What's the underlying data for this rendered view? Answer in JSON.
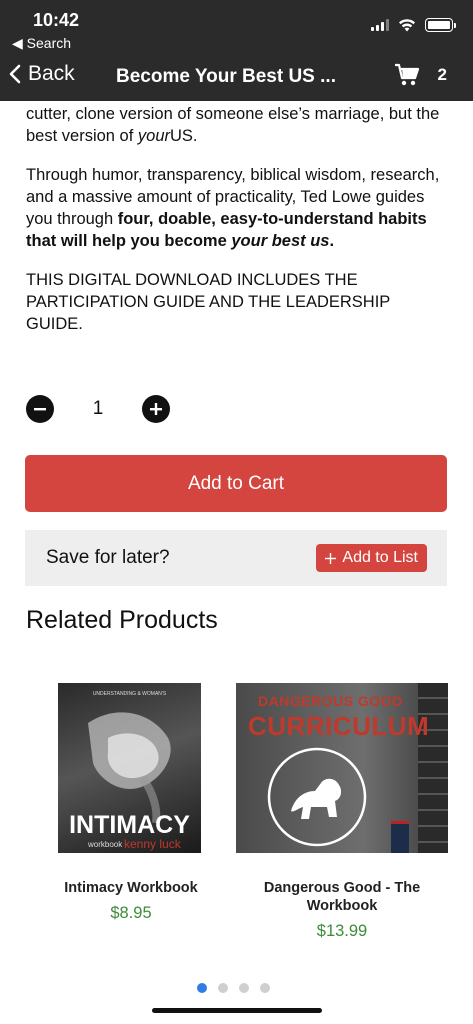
{
  "status": {
    "time": "10:42",
    "back_app": "◀ Search"
  },
  "nav": {
    "back_label": "Back",
    "title": "Become Your Best US ...",
    "cart_count": "2"
  },
  "description": {
    "p1_text": "cutter, clone version of someone else’s marriage, but the best version of ",
    "p1_italic": "your",
    "p1_tail": "US.",
    "p2_text": "Through humor, transparency, biblical wisdom, research, and a massive amount of practicality, Ted Lowe guides you through ",
    "p2_bold": "four, doable, easy-to-understand habits that will help you become ",
    "p2_bold_italic": "your best us",
    "p2_bold_end": ".",
    "p3_text": "THIS DIGITAL DOWNLOAD INCLUDES THE PARTICIPATION GUIDE AND THE LEADERSHIP GUIDE."
  },
  "quantity": {
    "value": "1"
  },
  "actions": {
    "add_to_cart": "Add to Cart",
    "save_for_later": "Save for later?",
    "add_to_list": "Add to List"
  },
  "related": {
    "title": "Related Products",
    "products": [
      {
        "name": "Intimacy Workbook",
        "price": "$8.95",
        "cover_top": "UNDERSTANDING & WOMAN'S",
        "cover_title": "INTIMACY",
        "cover_sub": "workbook",
        "cover_author": "kenny luck"
      },
      {
        "name": "Dangerous Good - The Workbook",
        "price": "$13.99",
        "cover_line1": "DANGEROUS GOOD",
        "cover_line2": "CURRICULUM"
      }
    ]
  },
  "pager": {
    "pages": 4,
    "active": 1
  },
  "colors": {
    "header_bg": "#2b2b2b",
    "accent_red": "#d44540",
    "price_green": "#3c8c3a",
    "pager_active": "#2f7de1"
  }
}
